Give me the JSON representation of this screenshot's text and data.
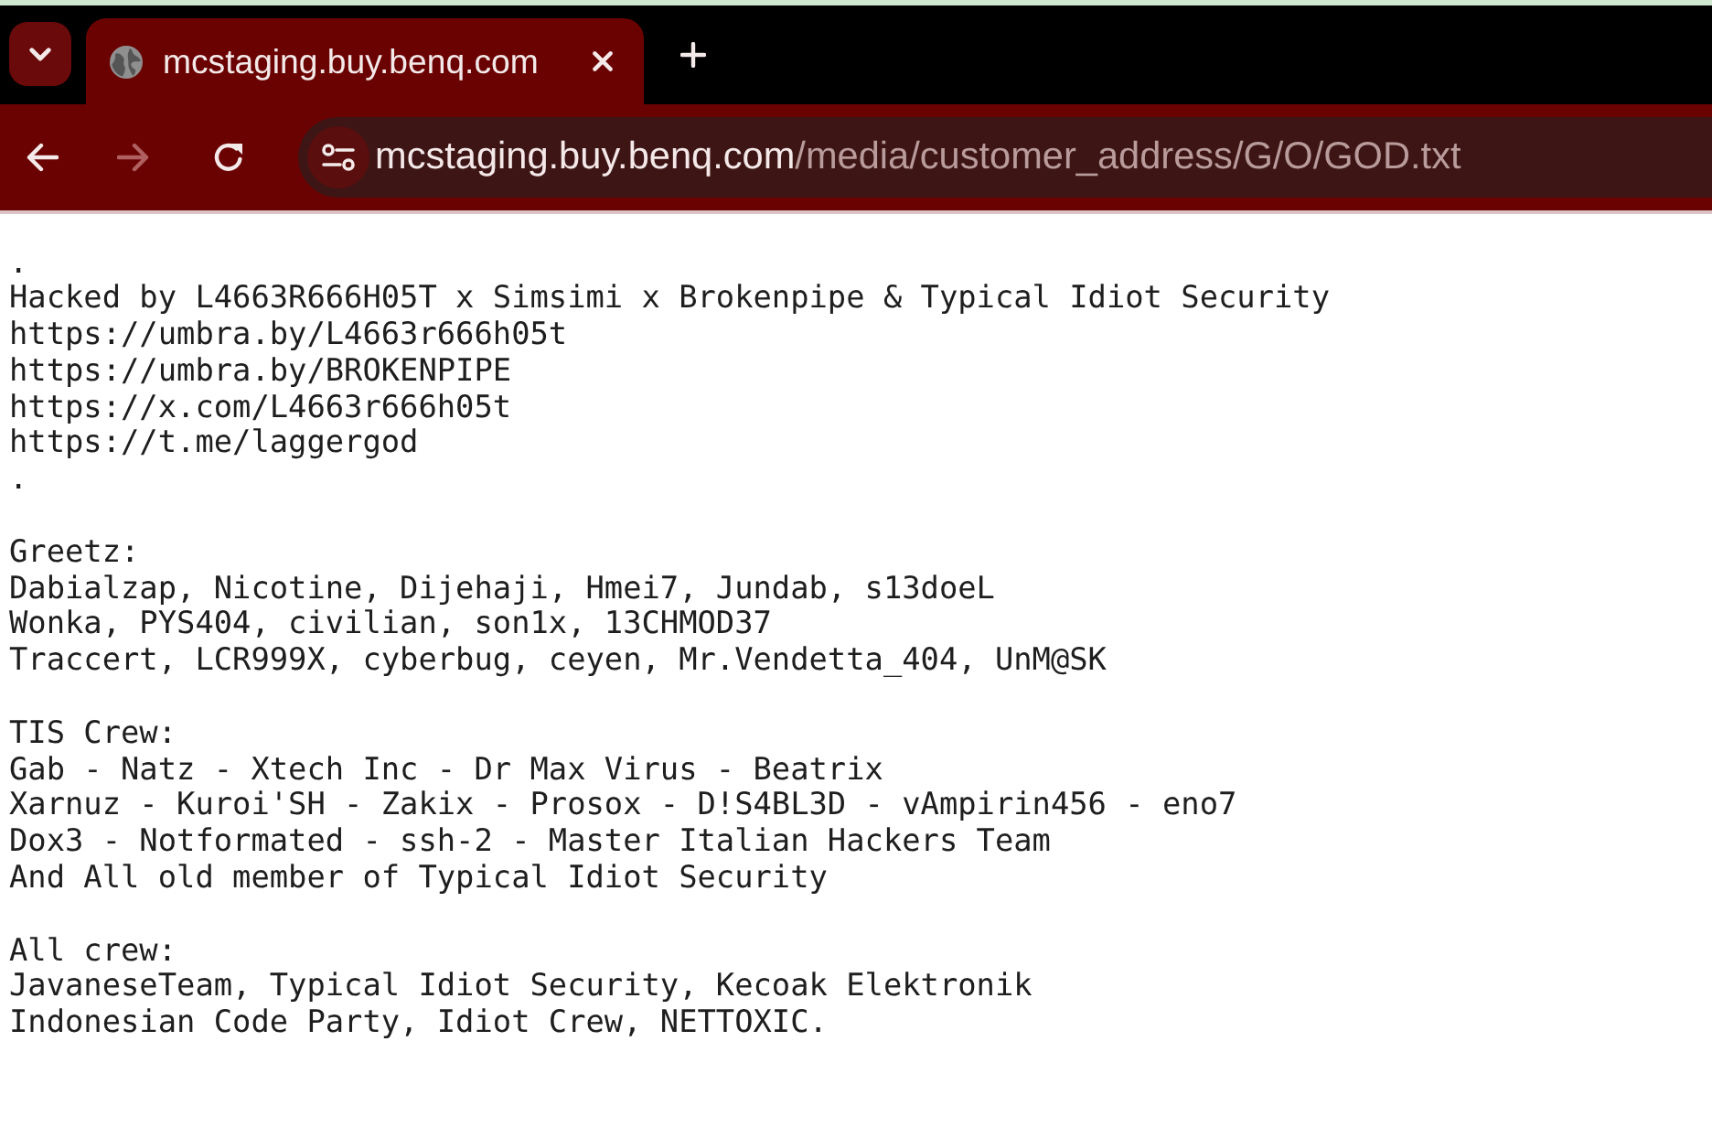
{
  "tab_strip": {
    "tabs": [
      {
        "title": "mcstaging.buy.benq.com",
        "selected": true
      }
    ]
  },
  "toolbar": {
    "buttons": [
      {
        "kind": "back",
        "disabled": false
      },
      {
        "kind": "forward",
        "disabled": true
      },
      {
        "kind": "reload",
        "disabled": false
      }
    ],
    "address": {
      "host": "mcstaging.buy.benq.com",
      "path": "/media/customer_address/G/O/GOD.txt"
    }
  },
  "document": {
    "blocks": [
      {
        "lines": [
          ".",
          "Hacked by L4663R666H05T x Simsimi x Brokenpipe & Typical Idiot Security",
          "https://umbra.by/L4663r666h05t",
          "https://umbra.by/BROKENPIPE",
          "https://x.com/L4663r666h05t",
          "https://t.me/laggergod",
          "."
        ]
      },
      {
        "lines": [
          "Greetz:",
          "Dabialzap, Nicotine, Dijehaji, Hmei7, Jundab, s13doeL",
          "Wonka, PYS404, civilian, son1x, 13CHMOD37",
          "Traccert, LCR999X, cyberbug, ceyen, Mr.Vendetta_404, UnM@SK"
        ]
      },
      {
        "lines": [
          "TIS Crew:",
          "Gab - Natz - Xtech Inc - Dr Max Virus - Beatrix",
          "Xarnuz - Kuroi'SH - Zakix - Prosox - D!S4BL3D - vAmpirin456 - eno7",
          "Dox3 - Notformated - ssh-2 - Master Italian Hackers Team",
          "And All old member of Typical Idiot Security"
        ]
      },
      {
        "lines": [
          "All crew:",
          "JavaneseTeam, Typical Idiot Security, Kecoak Elektronik",
          "Indonesian Code Party, Idiot Crew, NETTOXIC."
        ]
      }
    ]
  }
}
